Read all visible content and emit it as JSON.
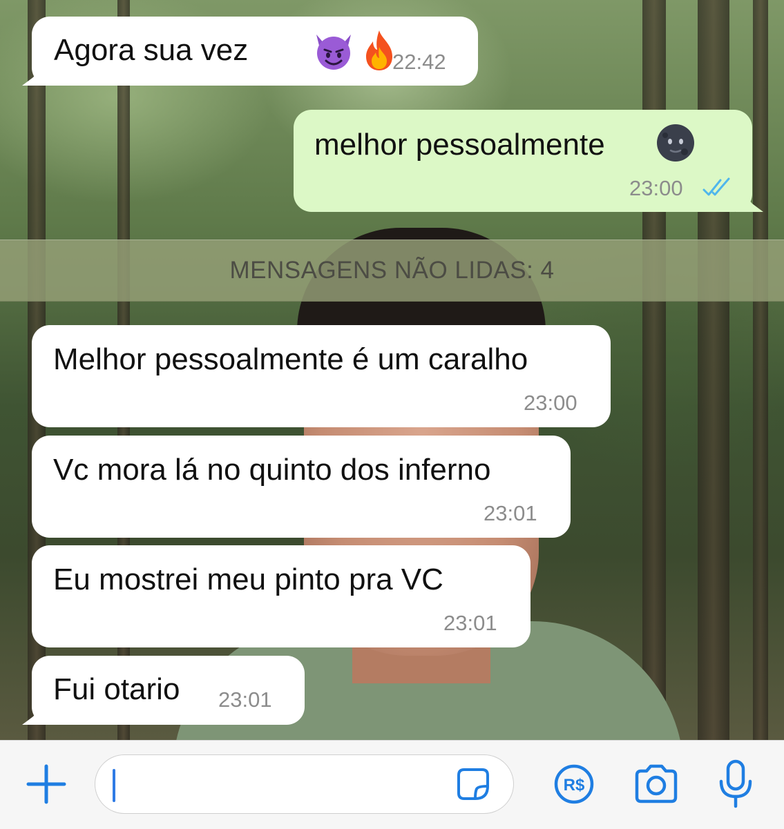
{
  "messages": [
    {
      "direction": "in",
      "text": "Agora sua vez",
      "emoji": [
        "smiling-devil",
        "fire"
      ],
      "time": "22:42"
    },
    {
      "direction": "out",
      "text": "melhor pessoalmente",
      "emoji": [
        "new-moon-face"
      ],
      "time": "23:00",
      "status": "read"
    },
    {
      "direction": "in",
      "text": "Melhor pessoalmente é um caralho",
      "time": "23:00"
    },
    {
      "direction": "in",
      "text": "Vc mora lá no quinto dos inferno",
      "time": "23:01"
    },
    {
      "direction": "in",
      "text": "Eu mostrei meu pinto pra VC",
      "time": "23:01"
    },
    {
      "direction": "in",
      "text": "Fui otario",
      "time": "23:01"
    }
  ],
  "unread_banner": "MENSAGENS NÃO LIDAS: 4",
  "input_bar": {
    "message_value": "",
    "icons": [
      "plus-icon",
      "sticker-icon",
      "payment-icon",
      "camera-icon",
      "microphone-icon"
    ],
    "payment_label": "R$"
  },
  "colors": {
    "incoming_bubble": "#ffffff",
    "outgoing_bubble": "#dcf8c6",
    "timestamp": "#8c8c8c",
    "read_ticks": "#4fb6ec",
    "accent_blue": "#1f7ee2",
    "unread_banner_text": "#4c4c44"
  }
}
